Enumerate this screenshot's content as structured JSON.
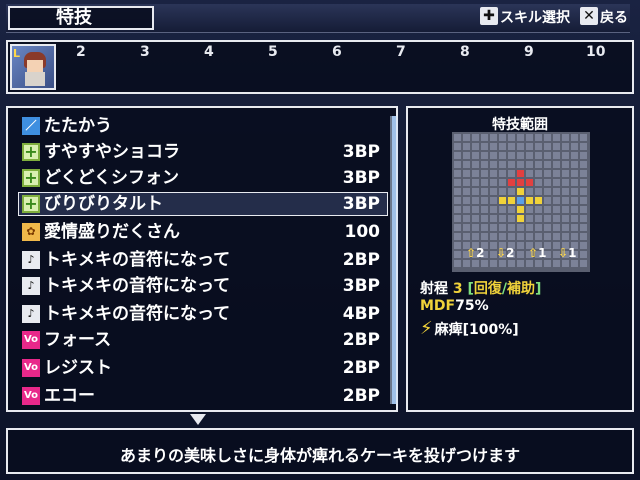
{
  "header": {
    "title": "特技",
    "hint_select": "スキル選択",
    "hint_back": "戻る"
  },
  "party_strip": {
    "active_badge": "L",
    "slots": [
      "2",
      "3",
      "4",
      "5",
      "6",
      "7",
      "8",
      "9",
      "10"
    ]
  },
  "skills": [
    {
      "icon": "attack-icon",
      "name": "たたかう",
      "cost": ""
    },
    {
      "icon": "heal-icon",
      "name": "すやすやショコラ",
      "cost": "3BP"
    },
    {
      "icon": "heal-icon",
      "name": "どくどくシフォン",
      "cost": "3BP"
    },
    {
      "icon": "heal-icon",
      "name": "びりびりタルト",
      "cost": "3BP",
      "selected": true
    },
    {
      "icon": "special-icon",
      "name": "愛情盛りだくさん",
      "cost": "100"
    },
    {
      "icon": "music-note-icon",
      "name": "トキメキの音符になって",
      "cost": "2BP"
    },
    {
      "icon": "music-note-icon",
      "name": "トキメキの音符になって",
      "cost": "3BP"
    },
    {
      "icon": "music-note-icon",
      "name": "トキメキの音符になって",
      "cost": "4BP"
    },
    {
      "icon": "voice-icon",
      "name": "フォース",
      "cost": "2BP"
    },
    {
      "icon": "voice-icon",
      "name": "レジスト",
      "cost": "2BP"
    },
    {
      "icon": "voice-icon",
      "name": "エコー",
      "cost": "2BP"
    }
  ],
  "icon_glyphs": {
    "attack": "／",
    "heal": "+",
    "special": "✿",
    "music": "♪",
    "voice": "Vo"
  },
  "range_panel": {
    "title": "特技範囲",
    "units": [
      {
        "arrow": "⇧",
        "value": "2"
      },
      {
        "arrow": "⇩",
        "value": "2"
      },
      {
        "arrow": "⇧",
        "value": "1"
      },
      {
        "arrow": "⇩",
        "value": "1"
      }
    ],
    "range_label": "射程",
    "range_value": "3",
    "range_type_open": "[",
    "range_type_a": "回復",
    "range_type_sep": "/",
    "range_type_b": "補助",
    "range_type_close": "]",
    "mdf_label": "MDF",
    "mdf_value": "75%",
    "effect_label": "麻痺[100%]"
  },
  "description": "あまりの美味しさに身体が痺れるケーキを投げつけます",
  "colors": {
    "accent_yellow": "#f0d23a",
    "accent_green": "#7fe07f",
    "range_red": "#e24040",
    "range_blue": "#5aa0e8",
    "panel_border": "#e8eaf0"
  }
}
